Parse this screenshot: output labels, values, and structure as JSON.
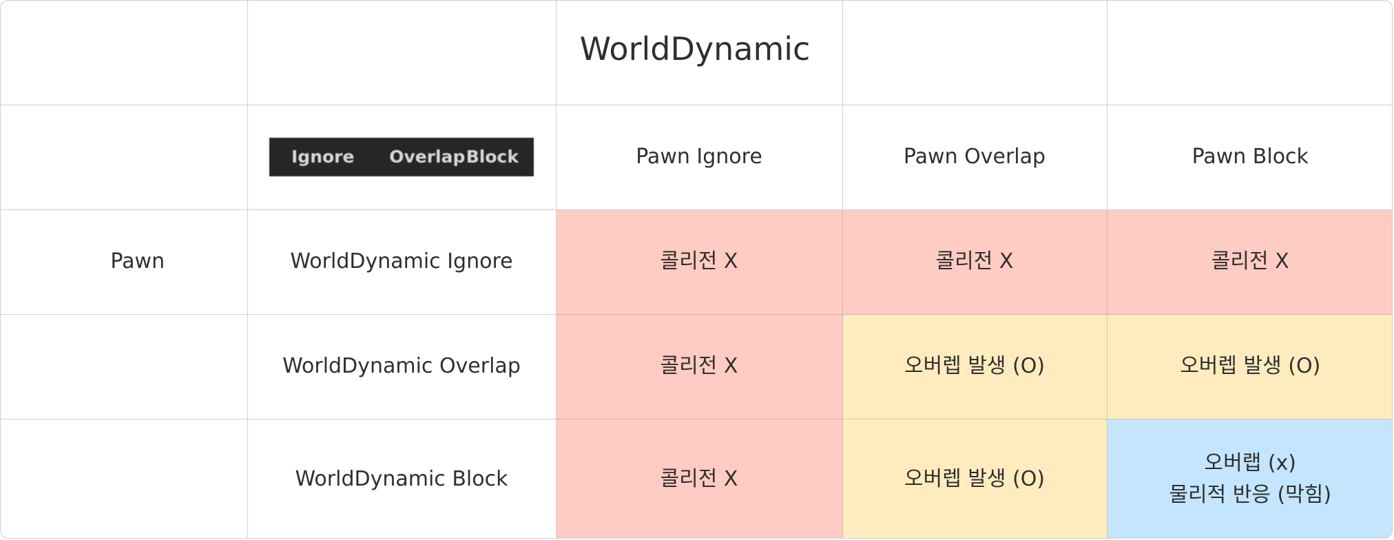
{
  "table": {
    "title": "WorldDynamic",
    "row_group_label": "Pawn",
    "legend": [
      "Ignore",
      "Overlap",
      "Block"
    ],
    "column_headers": [
      "Pawn Ignore",
      "Pawn Overlap",
      "Pawn Block"
    ],
    "rows": [
      {
        "label": "WorldDynamic Ignore",
        "cells": [
          {
            "text": "콜리전 X",
            "color": "#ffccc3"
          },
          {
            "text": "콜리전 X",
            "color": "#ffccc3"
          },
          {
            "text": "콜리전 X",
            "color": "#ffccc3"
          }
        ]
      },
      {
        "label": "WorldDynamic Overlap",
        "cells": [
          {
            "text": "콜리전 X",
            "color": "#ffccc3"
          },
          {
            "text": "오버렙 발생 (O)",
            "color": "#feecbf"
          },
          {
            "text": "오버렙 발생 (O)",
            "color": "#feecbf"
          }
        ]
      },
      {
        "label": "WorldDynamic Block",
        "cells": [
          {
            "text": "콜리전 X",
            "color": "#ffccc3"
          },
          {
            "text": "오버렙 발생 (O)",
            "color": "#feecbf"
          },
          {
            "lines": [
              "오버랩 (x)",
              "물리적 반응 (막힘)"
            ],
            "color": "#c3e5fd"
          }
        ]
      }
    ]
  }
}
